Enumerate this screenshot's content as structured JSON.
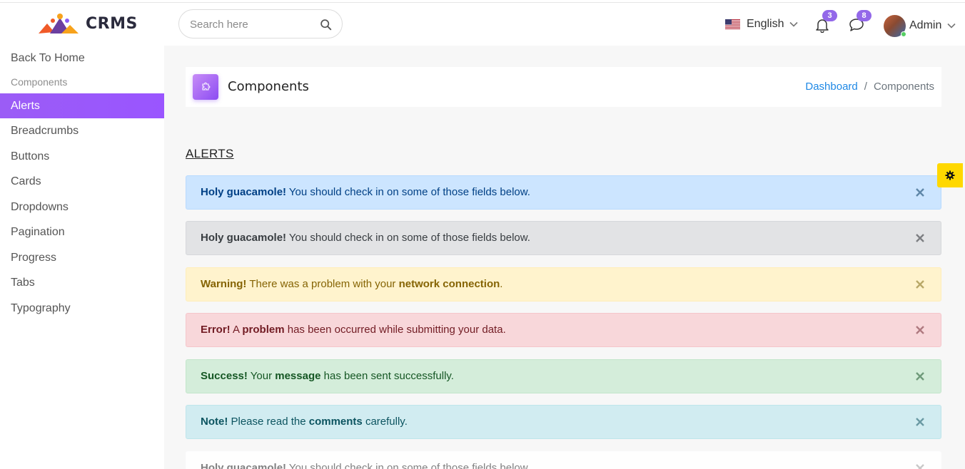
{
  "brand": {
    "name": "CRMS"
  },
  "search": {
    "placeholder": "Search here",
    "icon": "search-icon"
  },
  "header": {
    "language": "English",
    "notifications_count": "3",
    "messages_count": "8",
    "user_name": "Admin"
  },
  "sidebar": {
    "back_home": "Back To Home",
    "group_label": "Components",
    "items": [
      {
        "label": "Alerts",
        "active": true
      },
      {
        "label": "Breadcrumbs"
      },
      {
        "label": "Buttons"
      },
      {
        "label": "Cards"
      },
      {
        "label": "Dropdowns"
      },
      {
        "label": "Pagination"
      },
      {
        "label": "Progress"
      },
      {
        "label": "Tabs"
      },
      {
        "label": "Typography"
      }
    ]
  },
  "page": {
    "title": "Components",
    "breadcrumb": [
      "Dashboard",
      "Components"
    ],
    "section_title": "ALERTS"
  },
  "alerts": [
    {
      "variant": "primary",
      "strong": "Holy guacamole!",
      "text": " You should check in on some of those fields below."
    },
    {
      "variant": "secondary",
      "strong": "Holy guacamole!",
      "text": " You should check in on some of those fields below."
    },
    {
      "variant": "warning",
      "strong": "Warning!",
      "pre": " There was a problem with your ",
      "bold": "network connection",
      "post": "."
    },
    {
      "variant": "danger",
      "strong": "Error!",
      "pre": " A ",
      "bold": "problem",
      "post": " has been occurred while submitting your data."
    },
    {
      "variant": "success",
      "strong": "Success!",
      "pre": " Your ",
      "bold": "message",
      "post": " has been sent successfully."
    },
    {
      "variant": "info",
      "strong": "Note!",
      "pre": " Please read the ",
      "bold": "comments",
      "post": " carefully."
    },
    {
      "variant": "light",
      "strong": "Holy guacamole!",
      "text": " You should check in on some of those fields below."
    }
  ],
  "colors": {
    "accent": "#9a55ff",
    "badge": "#9368e9",
    "link": "#1e88e5",
    "settings_button": "#ffd800"
  }
}
